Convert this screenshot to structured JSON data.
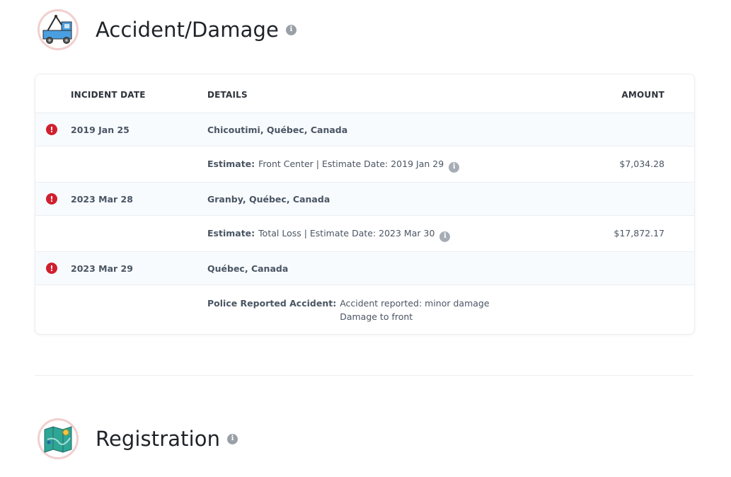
{
  "accident": {
    "title": "Accident/Damage",
    "icon": "tow-truck-icon",
    "info_icon": "i",
    "headers": {
      "date": "INCIDENT DATE",
      "details": "DETAILS",
      "amount": "AMOUNT"
    },
    "incidents": [
      {
        "date": "2019 Jan 25",
        "location": "Chicoutimi, Québec, Canada",
        "detail": {
          "label": "Estimate:",
          "text": "Front Center | Estimate Date: 2019 Jan 29",
          "amount": "$7,034.28"
        }
      },
      {
        "date": "2023 Mar 28",
        "location": "Granby, Québec, Canada",
        "detail": {
          "label": "Estimate:",
          "text": "Total Loss | Estimate Date: 2023 Mar 30",
          "amount": "$17,872.17"
        }
      },
      {
        "date": "2023 Mar 29",
        "location": "Québec, Canada",
        "detail": {
          "label": "Police Reported Accident:",
          "line1": "Accident reported: minor damage",
          "line2": "Damage to front"
        }
      }
    ]
  },
  "registration": {
    "title": "Registration",
    "icon": "map-icon",
    "info_icon": "i"
  },
  "colors": {
    "alert": "#d0202f",
    "badge_ring": "#f2cfcf",
    "truck_blue": "#4a9fe0",
    "map_teal": "#2fa596"
  }
}
